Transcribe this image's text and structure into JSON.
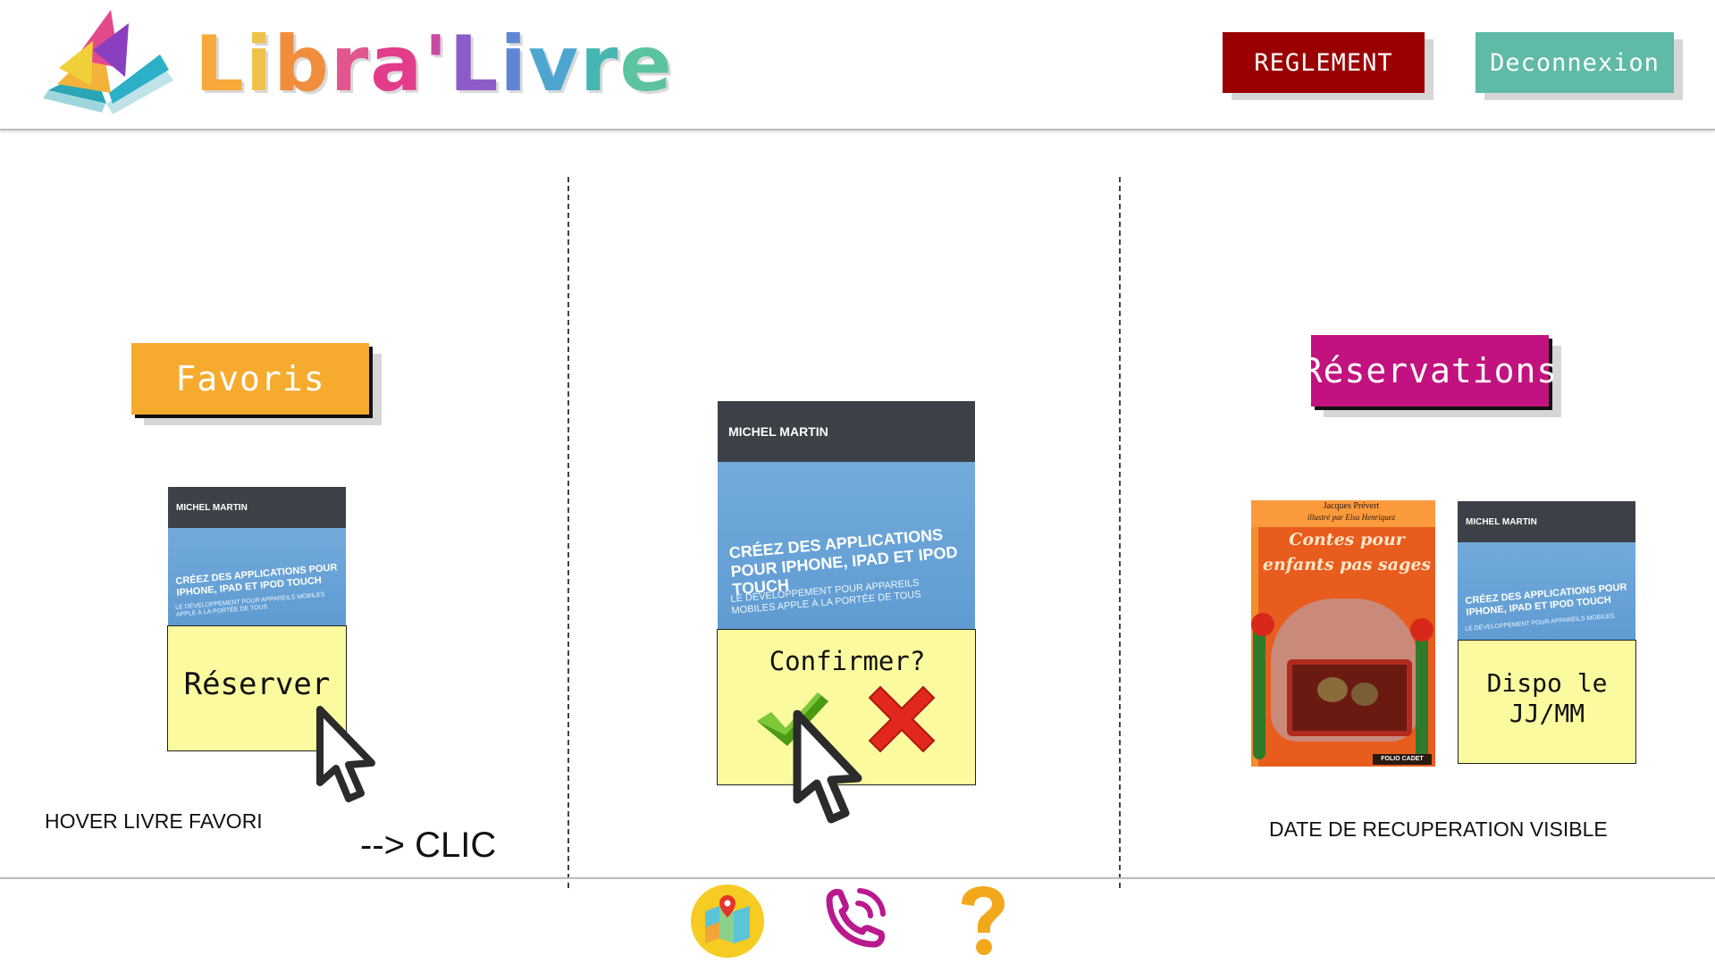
{
  "app": {
    "logo_text": "Libra'Livre",
    "logo_letters": [
      {
        "ch": "L",
        "color": "#f7a93b"
      },
      {
        "ch": "i",
        "color": "#f0c24a"
      },
      {
        "ch": "b",
        "color": "#f08e3e"
      },
      {
        "ch": "r",
        "color": "#e2568f"
      },
      {
        "ch": "a",
        "color": "#e23c8a"
      },
      {
        "ch": "'",
        "color": "#c74aa3"
      },
      {
        "ch": "L",
        "color": "#8c5bc7"
      },
      {
        "ch": "i",
        "color": "#5e86d6"
      },
      {
        "ch": "v",
        "color": "#4ea6d0"
      },
      {
        "ch": "r",
        "color": "#46b6b2"
      },
      {
        "ch": "e",
        "color": "#5bc39e"
      }
    ]
  },
  "header": {
    "reglement_label": "REGLEMENT",
    "deconnexion_label": "Deconnexion"
  },
  "colors": {
    "reglement": "#9b0000",
    "deconnexion": "#5fbaa7",
    "favoris": "#f6ab2f",
    "reservations": "#c2127f",
    "sticky": "#fbfa9e"
  },
  "step1": {
    "section_label": "Favoris",
    "book": {
      "author": "MICHEL MARTIN",
      "title": "CRÉEZ DES APPLICATIONS POUR IPHONE, IPAD ET IPOD TOUCH",
      "subtitle": "LE DÉVELOPPEMENT POUR APPAREILS MOBILES APPLE À LA PORTÉE DE TOUS"
    },
    "action_label": "Réserver",
    "note": "HOVER LIVRE FAVORI",
    "arrow_note": "--> CLIC"
  },
  "step2": {
    "book": {
      "author": "MICHEL MARTIN",
      "title": "CRÉEZ DES APPLICATIONS POUR IPHONE, IPAD ET IPOD TOUCH",
      "subtitle": "LE DÉVELOPPEMENT POUR APPAREILS MOBILES APPLE À LA PORTÉE DE TOUS"
    },
    "confirm_label": "Confirmer?",
    "confirm_icon": "check-icon",
    "cancel_icon": "cross-icon"
  },
  "step3": {
    "section_label": "Réservations",
    "book1": {
      "author": "Jacques Prévert",
      "illustrator": "illustré par Elsa Henriquez",
      "title": "Contes pour enfants pas sages",
      "publisher": "FOLIO CADET"
    },
    "book2": {
      "author": "MICHEL MARTIN",
      "title": "CRÉEZ DES APPLICATIONS POUR IPHONE, IPAD ET IPOD TOUCH",
      "subtitle": "LE DÉVELOPPEMENT POUR APPAREILS MOBILES"
    },
    "availability_label": "Dispo le JJ/MM",
    "note": "DATE DE RECUPERATION VISIBLE"
  },
  "footer": {
    "icons": [
      "map-icon",
      "phone-icon",
      "help-icon"
    ]
  }
}
